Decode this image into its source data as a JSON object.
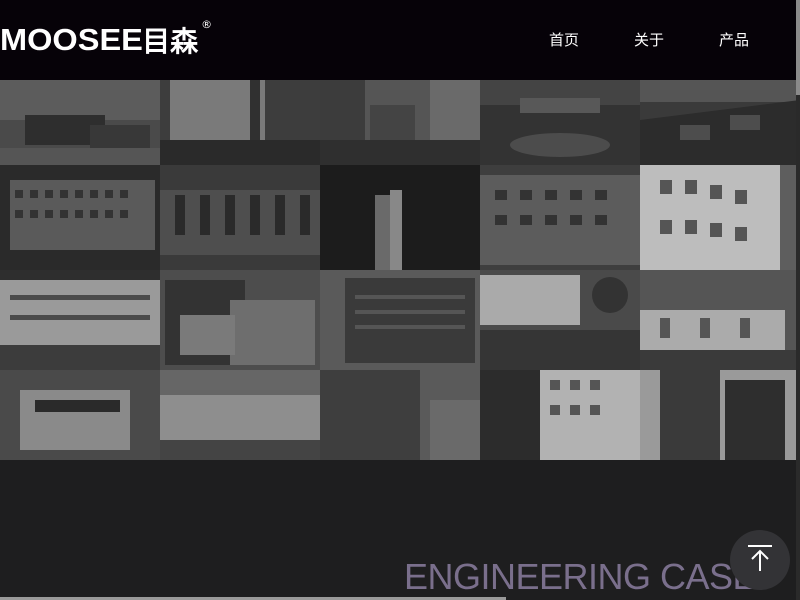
{
  "brand": {
    "latin": "MOOSEE",
    "cjk": "目森",
    "mark": "®"
  },
  "nav": {
    "items": [
      "首页",
      "关于",
      "产品"
    ]
  },
  "section": {
    "title": "ENGINEERING CASE"
  },
  "icons": {
    "back_to_top": "arrow-up-to-line-icon"
  },
  "colors": {
    "header_bg": "#060208",
    "page_bg": "#1e1e1f",
    "title_color": "#7a6f8c"
  }
}
